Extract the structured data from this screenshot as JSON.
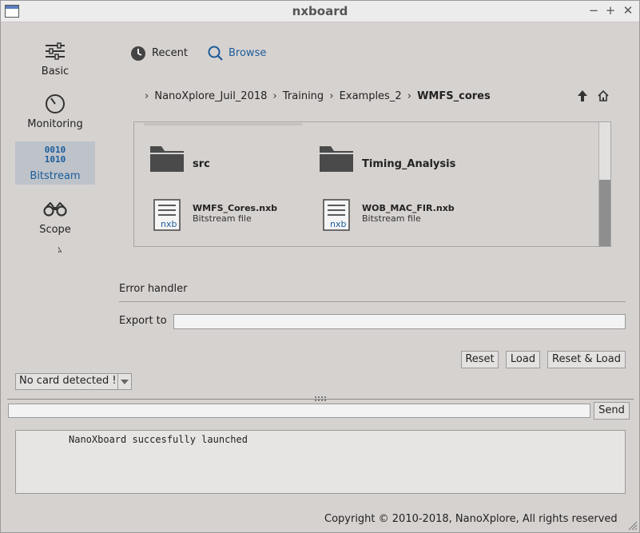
{
  "window": {
    "title": "nxboard"
  },
  "sidebar": {
    "items": [
      {
        "label": "Basic"
      },
      {
        "label": "Monitoring"
      },
      {
        "label": "Bitstream",
        "icon_text": [
          "0010",
          "1010"
        ]
      },
      {
        "label": "Scope"
      }
    ]
  },
  "browser": {
    "recent_label": "Recent",
    "browse_label": "Browse",
    "breadcrumb": [
      "NanoXplore_Juil_2018",
      "Training",
      "Examples_2",
      "WMFS_cores"
    ],
    "folders": [
      {
        "name": "src"
      },
      {
        "name": "Timing_Analysis"
      }
    ],
    "files": [
      {
        "name": "WMFS_Cores.nxb",
        "type": "Bitstream file",
        "icon_text": "nxb"
      },
      {
        "name": "WOB_MAC_FIR.nxb",
        "type": "Bitstream file",
        "icon_text": "nxb"
      }
    ]
  },
  "error_handler": {
    "section_label": "Error handler",
    "export_label": "Export to",
    "export_value": ""
  },
  "actions": {
    "reset": "Reset",
    "load": "Load",
    "reset_load": "Reset & Load"
  },
  "card_select": {
    "value": "No card detected !"
  },
  "console": {
    "input_value": "",
    "send_label": "Send",
    "log_line": "NanoXboard succesfully launched"
  },
  "footer": {
    "copyright": "Copyright © 2010-2018, NanoXplore, All rights reserved"
  },
  "colors": {
    "accent": "#1c5c9b",
    "background": "#d6d2d0",
    "selected": "#bdc3c9"
  }
}
